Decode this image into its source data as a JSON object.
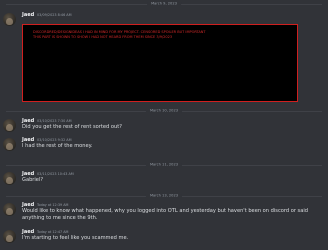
{
  "dividers": [
    "March 9, 2023",
    "March 10, 2023",
    "March 11, 2023",
    "March 13, 2023"
  ],
  "messages": [
    {
      "author": "Jaed",
      "time": "03/09/2023 8:46 AM",
      "text": ""
    },
    {
      "author": "Jaed",
      "time": "03/10/2023 7:30 AM",
      "text": "Did you get the rest of rent sorted out?"
    },
    {
      "author": "Jaed",
      "time": "03/10/2023 9:32 AM",
      "text": "I had the rest of the money."
    },
    {
      "author": "Jaed",
      "time": "03/11/2023 10:43 AM",
      "text": "Gabriel?"
    },
    {
      "author": "Jaed",
      "time": "Today at 12:39 AM",
      "text": "Would like to know what happened, why you logged into OTL and yesterday but haven't been on discord or said anything to me since the 9th."
    },
    {
      "author": "Jaed",
      "time": "Today at 12:47 AM",
      "text": "I'm starting to feel like you scammed me."
    }
  ],
  "redacted_note": "DISCORDRED/DESIGNIDEAS I HAD IN MIND FOR MY PROJECT. CENSORED SPOILER BUT IMPORTANT THIS PART IS SHOWN TO SHOW I HAD NOT HEARD FROM THEM SINCE 3/9/2023",
  "colors": {
    "background": "#313338",
    "redacted_border": "#d01f1f",
    "redacted_text": "#d52a2a"
  }
}
